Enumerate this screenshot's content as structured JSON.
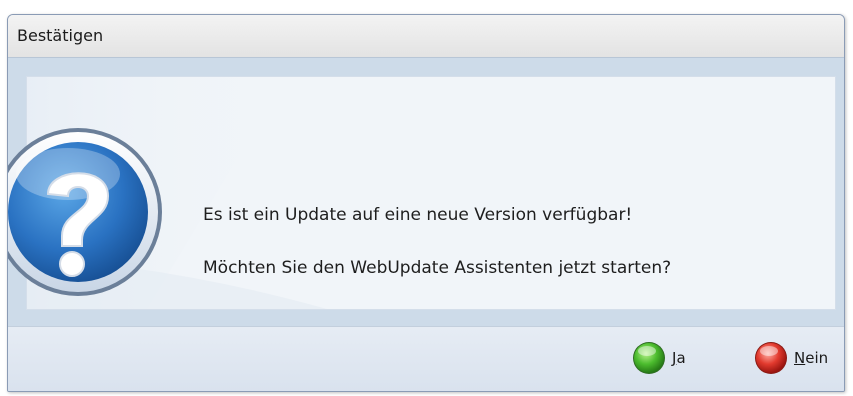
{
  "dialog": {
    "title": "Bestätigen",
    "message_line1": "Es ist ein Update auf eine neue Version verfügbar!",
    "message_line2": "Möchten Sie den WebUpdate Assistenten jetzt starten?",
    "icon": "question-icon"
  },
  "buttons": {
    "yes": {
      "accel": "J",
      "rest": "a",
      "icon": "green-orb-icon",
      "color": "#3fae2a"
    },
    "no": {
      "accel": "N",
      "rest": "ein",
      "icon": "red-orb-icon",
      "color": "#d42a2a"
    }
  }
}
